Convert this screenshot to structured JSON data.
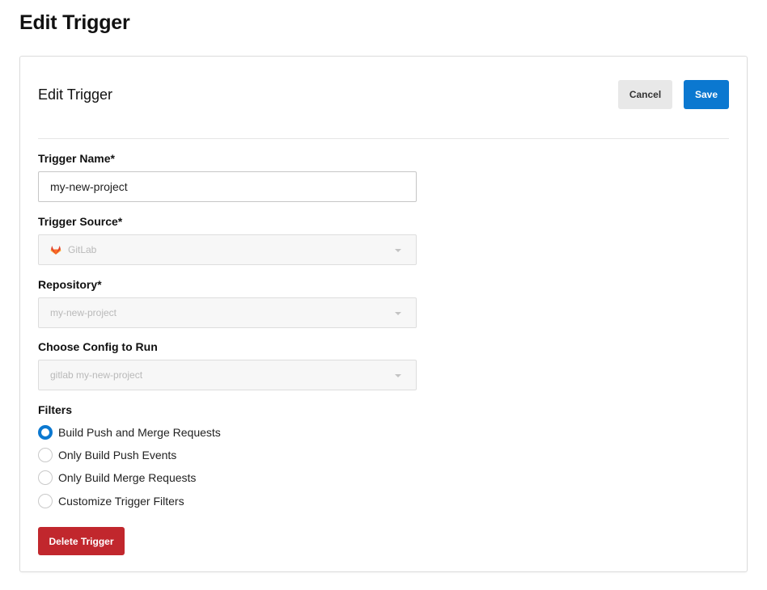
{
  "page": {
    "title": "Edit Trigger"
  },
  "card": {
    "title": "Edit Trigger",
    "cancel_label": "Cancel",
    "save_label": "Save"
  },
  "form": {
    "trigger_name": {
      "label": "Trigger Name*",
      "value": "my-new-project"
    },
    "trigger_source": {
      "label": "Trigger Source*",
      "value": "GitLab",
      "icon": "gitlab-icon",
      "disabled": true
    },
    "repository": {
      "label": "Repository*",
      "value": "my-new-project",
      "disabled": true
    },
    "config": {
      "label": "Choose Config to Run",
      "value": "gitlab my-new-project",
      "disabled": true
    },
    "filters": {
      "label": "Filters",
      "options": [
        {
          "label": "Build Push and Merge Requests",
          "checked": true
        },
        {
          "label": "Only Build Push Events",
          "checked": false
        },
        {
          "label": "Only Build Merge Requests",
          "checked": false
        },
        {
          "label": "Customize Trigger Filters",
          "checked": false
        }
      ]
    },
    "delete_label": "Delete Trigger"
  },
  "colors": {
    "primary": "#0b78d0",
    "danger": "#c1272d",
    "gitlab_orange": "#e24329"
  }
}
